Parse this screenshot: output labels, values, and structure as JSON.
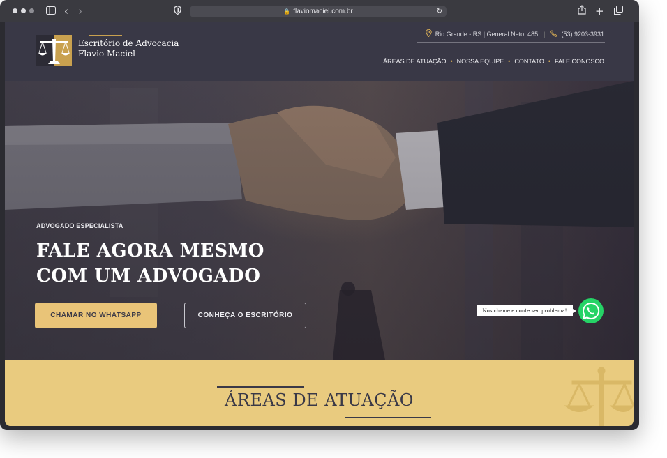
{
  "browser": {
    "url": "flaviomaciel.com.br",
    "icons": [
      "sidebar-icon",
      "back-icon",
      "forward-icon",
      "shield-icon",
      "lock-icon",
      "reload-icon",
      "share-icon",
      "new-tab-icon",
      "tabs-overview-icon"
    ]
  },
  "header": {
    "brand_line1": "Escritório de Advocacia",
    "brand_line2": "Flavio Maciel",
    "address": "Rio Grande - RS | General Neto, 485",
    "phone": "(53) 9203-3931",
    "nav": [
      {
        "label": "ÁREAS DE ATUAÇÃO"
      },
      {
        "label": "NOSSA EQUIPE"
      },
      {
        "label": "CONTATO"
      },
      {
        "label": "FALE CONOSCO"
      }
    ]
  },
  "hero": {
    "eyebrow": "ADVOGADO ESPECIALISTA",
    "headline": "FALE AGORA MESMO\nCOM UM ADVOGADO",
    "primary_cta": "CHAMAR NO WHATSAPP",
    "secondary_cta": "CONHEÇA O ESCRITÓRIO"
  },
  "whatsapp": {
    "tooltip": "Nos chame e conte seu problema!"
  },
  "areas": {
    "title": "ÁREAS DE ATUAÇÃO"
  },
  "colors": {
    "brand_dark": "#3a3947",
    "gold": "#d6ac55",
    "section_yellow": "#e9cb7f",
    "whatsapp_green": "#25d366"
  }
}
